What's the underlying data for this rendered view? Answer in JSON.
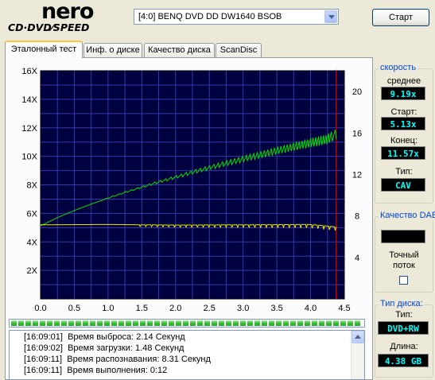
{
  "logo": {
    "brand": "nero",
    "product": "CD·DVD⁄SPEED"
  },
  "drive_select": {
    "value": "[4:0]  BENQ DVD DD DW1640 BSOB"
  },
  "start_button": {
    "label": "Старт"
  },
  "tabs": [
    {
      "label": "Эталонный тест",
      "active": true
    },
    {
      "label": "Инф. о диске",
      "active": false
    },
    {
      "label": "Качество диска",
      "active": false
    },
    {
      "label": "ScanDisc",
      "active": false
    }
  ],
  "speed_panel": {
    "title": "скорость",
    "avg_label": "среднее",
    "avg_value": "9.19x",
    "start_label": "Старт:",
    "start_value": "5.13x",
    "end_label": "Конец:",
    "end_value": "11.57x",
    "type_label": "Тип:",
    "type_value": "CAV"
  },
  "dae_panel": {
    "title": "Качество DAE",
    "accurate_label_1": "Точный",
    "accurate_label_2": "поток",
    "accurate_checked": false
  },
  "disc_panel": {
    "title": "Тип диска:",
    "type_label": "Тип:",
    "type_value": "DVD+RW",
    "length_label": "Длина:",
    "length_value": "4.38 GB"
  },
  "progress": {
    "fraction": 1.0
  },
  "log": [
    {
      "time": "[16:09:01]",
      "text": "Время выброса: 2.14 Секунд"
    },
    {
      "time": "[16:09:02]",
      "text": "Время загрузки: 1.48 Секунд"
    },
    {
      "time": "[16:09:11]",
      "text": "Время распознавания: 8.31 Секунд"
    },
    {
      "time": "[16:09:11]",
      "text": "Время выполнения:  0:12"
    }
  ],
  "chart_data": {
    "type": "line",
    "xlim": [
      0,
      4.5
    ],
    "ylim_left": [
      0,
      16
    ],
    "ylim_right": [
      0,
      22
    ],
    "x_ticks": [
      "0.0",
      "0.5",
      "1.0",
      "1.5",
      "2.0",
      "2.5",
      "3.0",
      "3.5",
      "4.0",
      "4.5"
    ],
    "y_left_ticks": [
      "2X",
      "4X",
      "6X",
      "8X",
      "10X",
      "12X",
      "14X",
      "16X"
    ],
    "y_right_ticks": [
      "4",
      "8",
      "12",
      "16",
      "20"
    ],
    "end_marker_x": 4.38,
    "grid": true,
    "colors": {
      "background": "#000040",
      "grid": "#3838a8",
      "read_speed": "#00e000",
      "rotation": "#e8e800",
      "marker": "#c00000"
    },
    "series": [
      {
        "color": "green",
        "start": [
          0.0,
          5.13
        ],
        "end": [
          4.38,
          11.57
        ],
        "points": [
          [
            0.0,
            5.13
          ],
          [
            0.25,
            5.7
          ],
          [
            0.5,
            6.2
          ],
          [
            0.75,
            6.65
          ],
          [
            1.0,
            7.07
          ],
          [
            1.25,
            7.47
          ],
          [
            1.5,
            7.84
          ],
          [
            1.75,
            8.2
          ],
          [
            2.0,
            8.54
          ],
          [
            2.25,
            8.88
          ],
          [
            2.5,
            9.2
          ],
          [
            2.75,
            9.51
          ],
          [
            3.0,
            9.81
          ],
          [
            3.25,
            10.1
          ],
          [
            3.5,
            10.39
          ],
          [
            3.75,
            10.67
          ],
          [
            4.0,
            10.95
          ],
          [
            4.25,
            11.2
          ],
          [
            4.38,
            11.57
          ]
        ]
      },
      {
        "color": "yellow",
        "points": [
          [
            0.0,
            5.2
          ],
          [
            1.0,
            5.22
          ],
          [
            2.0,
            5.18
          ],
          [
            3.0,
            5.2
          ],
          [
            4.0,
            5.22
          ],
          [
            4.38,
            5.05
          ]
        ]
      }
    ]
  }
}
